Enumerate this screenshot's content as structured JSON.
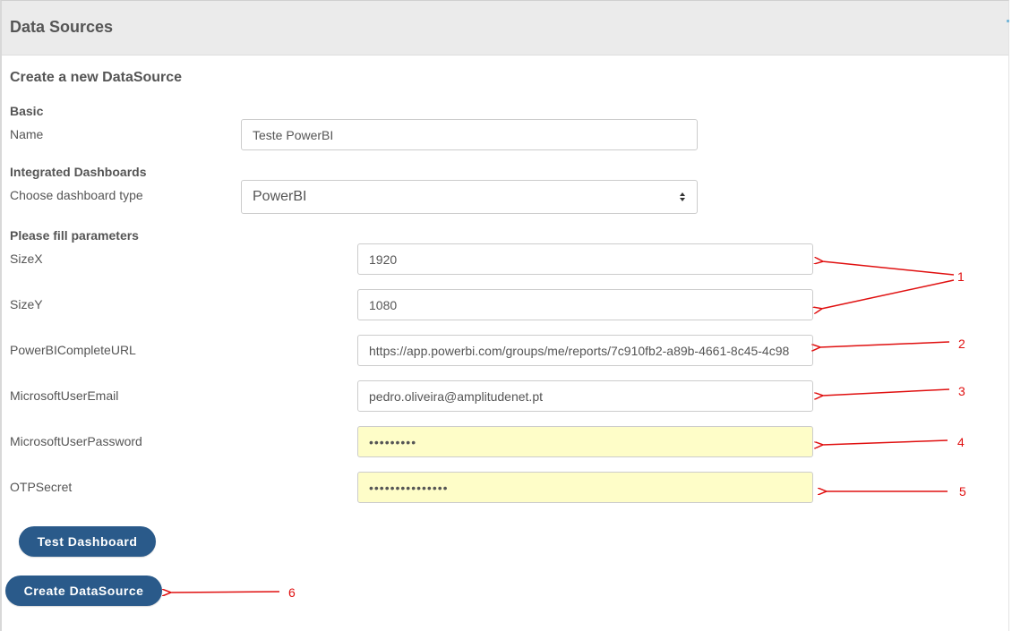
{
  "header": {
    "title": "Data Sources"
  },
  "form": {
    "title": "Create a new DataSource",
    "basic": {
      "section": "Basic",
      "name_label": "Name",
      "name_value": "Teste PowerBI"
    },
    "integrated": {
      "section": "Integrated Dashboards",
      "type_label": "Choose dashboard type",
      "type_value": "PowerBI"
    },
    "params": {
      "section": "Please fill parameters",
      "sizex_label": "SizeX",
      "sizex_value": "1920",
      "sizey_label": "SizeY",
      "sizey_value": "1080",
      "url_label": "PowerBICompleteURL",
      "url_value": "https://app.powerbi.com/groups/me/reports/7c910fb2-a89b-4661-8c45-4c98",
      "email_label": "MicrosoftUserEmail",
      "email_value": "pedro.oliveira@amplitudenet.pt",
      "password_label": "MicrosoftUserPassword",
      "password_value": "•••••••••",
      "otp_label": "OTPSecret",
      "otp_value": "•••••••••••••••"
    },
    "buttons": {
      "test_label": "Test Dashboard",
      "create_label": "Create DataSource"
    }
  },
  "annotations": {
    "n1": "1",
    "n2": "2",
    "n3": "3",
    "n4": "4",
    "n5": "5",
    "n6": "6",
    "color": "#e01010"
  },
  "colors": {
    "button": "#2a5a8a",
    "autofill": "#fefdc8",
    "header": "#ebebeb"
  }
}
